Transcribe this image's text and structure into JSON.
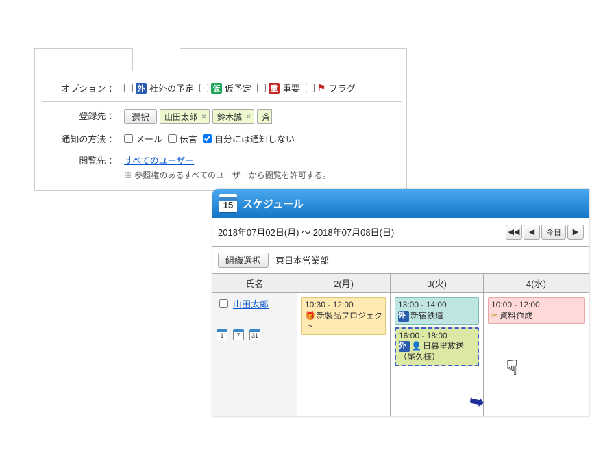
{
  "options_panel": {
    "labels": {
      "options": "オプション ：",
      "register_to": "登録先 ：",
      "notify_method": "通知の方法 ：",
      "viewers": "閲覧先 ："
    },
    "tags": {
      "external": {
        "badge": "外",
        "text": "社外の予定"
      },
      "tentative": {
        "badge": "仮",
        "text": "仮予定"
      },
      "important": {
        "badge": "重",
        "text": "重要"
      },
      "flag": {
        "text": "フラグ"
      }
    },
    "register": {
      "select_btn": "選択",
      "names": [
        "山田太郎",
        "鈴木誠",
        "斉"
      ]
    },
    "notify": {
      "mail": "メール",
      "message": "伝言",
      "no_self": "自分には通知しない"
    },
    "viewers_link": "すべてのユーザー",
    "viewers_note": "※ 参照権のあるすべてのユーザーから閲覧を許可する。"
  },
  "schedule": {
    "icon_day": "15",
    "title": "スケジュール",
    "range": "2018年07月02日(月) ～ 2018年07月08日(日)",
    "today_btn": "今日",
    "org_select_btn": "組織選択",
    "org_name": "東日本営業部",
    "columns": {
      "name": "氏名",
      "d2": "2(月)",
      "d3": "3(火)",
      "d4": "4(水)"
    },
    "row": {
      "user": "山田太郎",
      "mini": [
        "1",
        "7",
        "31"
      ],
      "d2": {
        "time": "10:30 - 12:00",
        "text": "新製品プロジェクト"
      },
      "d3a": {
        "time": "13:00 - 14:00",
        "text": "新宿鉄道",
        "badge": "外"
      },
      "d3b": {
        "time": "16:00 - 18:00",
        "text": "日暮里放送（尾久様）",
        "badge": "外"
      },
      "d4": {
        "time": "10:00 - 12:00",
        "text": "資料作成"
      }
    }
  }
}
